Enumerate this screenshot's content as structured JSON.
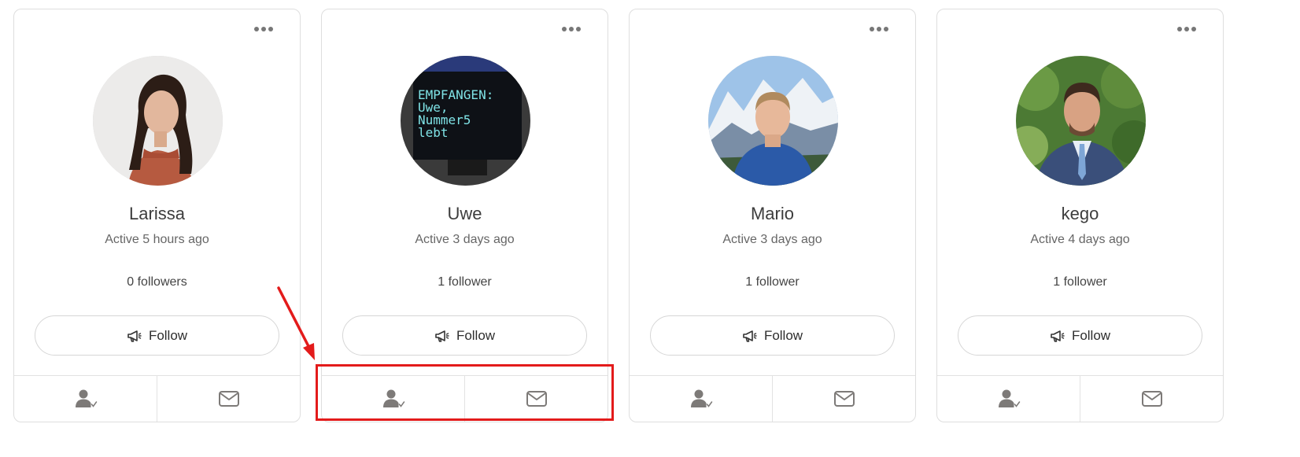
{
  "cards": [
    {
      "name": "Larissa",
      "active": "Active 5 hours ago",
      "followers": "0 followers",
      "follow_label": "Follow",
      "avatar": "woman-portrait"
    },
    {
      "name": "Uwe",
      "active": "Active 3 days ago",
      "followers": "1 follower",
      "follow_label": "Follow",
      "avatar": "oled-display",
      "avatar_text": [
        "EMPFANGEN:",
        "Uwe,",
        "Nummer5",
        "lebt"
      ]
    },
    {
      "name": "Mario",
      "active": "Active 3 days ago",
      "followers": "1 follower",
      "follow_label": "Follow",
      "avatar": "man-mountains"
    },
    {
      "name": "kego",
      "active": "Active 4 days ago",
      "followers": "1 follower",
      "follow_label": "Follow",
      "avatar": "man-suit-garden"
    }
  ],
  "icons": {
    "more": "more-dots-icon",
    "follow": "megaphone-icon",
    "friend": "user-check-icon",
    "message": "envelope-icon"
  },
  "annotation": {
    "color": "#e31b1b"
  }
}
